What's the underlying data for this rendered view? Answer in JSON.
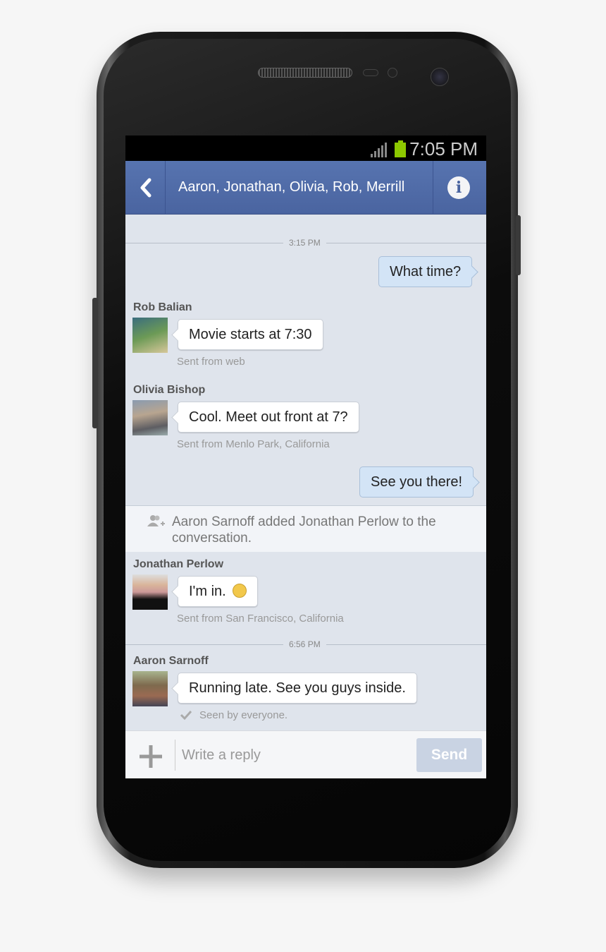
{
  "status_bar": {
    "time": "7:05 PM",
    "battery_color": "#8cc800"
  },
  "header": {
    "title": "Aaron, Jonathan, Olivia, Rob, Merrill",
    "back_icon": "chevron-left-icon",
    "info_icon": "info-icon",
    "color": "#5270ac"
  },
  "messages": {
    "divider1": "3:15 PM",
    "m1": {
      "text": "What time?"
    },
    "m2": {
      "sender": "Rob Balian",
      "text": "Movie starts at 7:30",
      "meta": "Sent from web"
    },
    "m3": {
      "sender": "Olivia Bishop",
      "text": "Cool. Meet out front at 7?",
      "meta": "Sent from Menlo Park, California"
    },
    "m4": {
      "text": "See you there!"
    },
    "system": "Aaron Sarnoff added Jonathan Perlow to the conversation.",
    "m5": {
      "sender": "Jonathan Perlow",
      "text": "I'm in.",
      "emoji": "😃",
      "meta": "Sent from San Francisco, California"
    },
    "divider2": "6:56 PM",
    "m6": {
      "sender": "Aaron Sarnoff",
      "text": "Running late. See you guys inside.",
      "meta": "Seen by everyone."
    }
  },
  "composer": {
    "placeholder": "Write a reply",
    "send_label": "Send"
  }
}
